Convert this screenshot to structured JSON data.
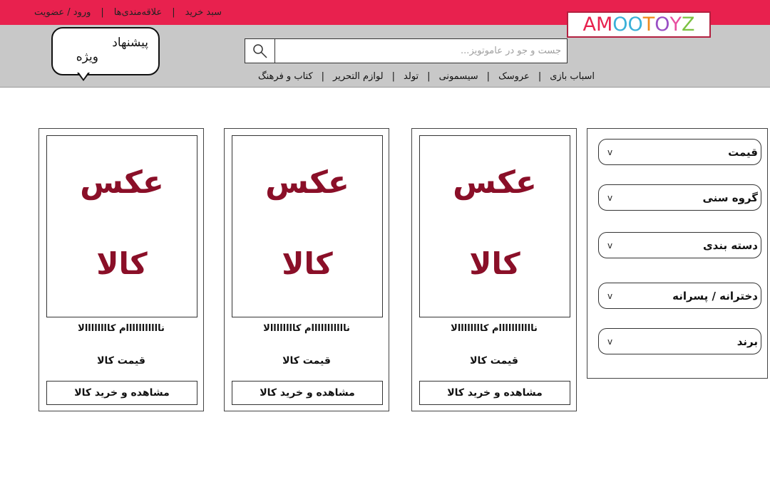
{
  "top_links": {
    "cart": "سبد خرید",
    "favorites": "علاقه‌مندی‌ها",
    "login": "ورود / عضویت"
  },
  "logo": {
    "letters": [
      {
        "ch": "A",
        "color": "#e8214e"
      },
      {
        "ch": "M",
        "color": "#e8214e"
      },
      {
        "ch": "O",
        "color": "#3ab0d8"
      },
      {
        "ch": "O",
        "color": "#3ab0d8"
      },
      {
        "ch": "T",
        "color": "#f08a1c"
      },
      {
        "ch": "O",
        "color": "#9a4fc4"
      },
      {
        "ch": "Y",
        "color": "#e84fa0"
      },
      {
        "ch": "Z",
        "color": "#7cc242"
      }
    ]
  },
  "special_offer": {
    "line1": "پیشنهاد",
    "line2": "ویژه"
  },
  "search": {
    "placeholder": "جست و جو در عاموتویز...",
    "icon": "search-icon"
  },
  "categories": [
    "اسباب بازی",
    "عروسک",
    "سیسمونی",
    "تولد",
    "لوازم التحریر",
    "کتاب و فرهنگ"
  ],
  "filters": [
    {
      "label": "قیمت",
      "icon": "chevron-down-icon"
    },
    {
      "label": "گروه سنی",
      "icon": "chevron-down-icon"
    },
    {
      "label": "دسته بندی",
      "icon": "chevron-down-icon"
    },
    {
      "label": "دخترانه / پسرانه",
      "icon": "chevron-down-icon"
    },
    {
      "label": "برند",
      "icon": "chevron-down-icon"
    }
  ],
  "products": [
    {
      "image_line1": "عکس",
      "image_line2": "کالا",
      "name": "نااااااااااام کاااااااالا",
      "price": "قیمت کالا",
      "button": "مشاهده و خرید کالا"
    },
    {
      "image_line1": "عکس",
      "image_line2": "کالا",
      "name": "نااااااااااام کاااااااالا",
      "price": "قیمت کالا",
      "button": "مشاهده و خرید کالا"
    },
    {
      "image_line1": "عکس",
      "image_line2": "کالا",
      "name": "نااااااااااام کاااااااالا",
      "price": "قیمت کالا",
      "button": "مشاهده و خرید کالا"
    }
  ]
}
